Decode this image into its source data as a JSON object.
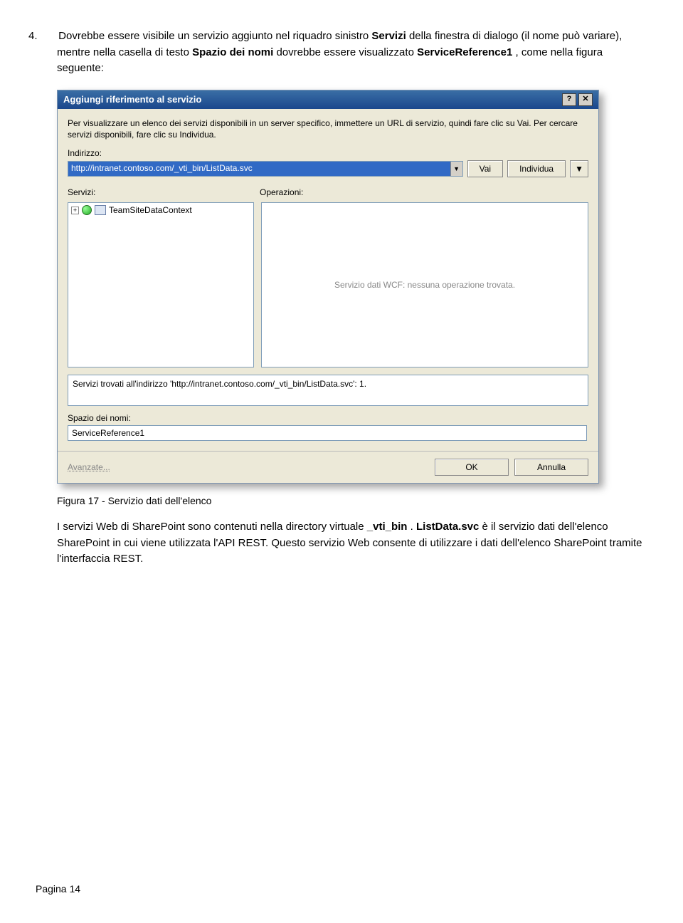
{
  "step": {
    "number": "4.",
    "text_before": "Dovrebbe essere visibile un servizio aggiunto nel riquadro sinistro ",
    "bold1": "Servizi",
    "text_mid1": " della finestra di dialogo (il nome può variare), mentre nella casella di testo ",
    "bold2": "Spazio dei nomi",
    "text_mid2": " dovrebbe essere visualizzato ",
    "bold3": "ServiceReference1",
    "text_after": ", come nella figura seguente:"
  },
  "dialog": {
    "title": "Aggiungi riferimento al servizio",
    "help_btn": "?",
    "close_btn": "✕",
    "desc": "Per visualizzare un elenco dei servizi disponibili in un server specifico, immettere un URL di servizio, quindi fare clic su Vai. Per cercare servizi disponibili, fare clic su Individua.",
    "address_lbl": "Indirizzo:",
    "address_val": "http://intranet.contoso.com/_vti_bin/ListData.svc",
    "go_btn": "Vai",
    "discover_btn": "Individua",
    "dd": "▼",
    "services_lbl": "Servizi:",
    "operations_lbl": "Operazioni:",
    "tree_item": "TeamSiteDataContext",
    "ops_empty": "Servizio dati WCF: nessuna operazione trovata.",
    "status": "Servizi trovati all'indirizzo 'http://intranet.contoso.com/_vti_bin/ListData.svc': 1.",
    "ns_lbl": "Spazio dei nomi:",
    "ns_val": "ServiceReference1",
    "advanced": "Avanzate...",
    "ok": "OK",
    "cancel": "Annulla"
  },
  "caption": "Figura 17 - Servizio dati dell'elenco",
  "after": {
    "p1a": "I servizi Web di SharePoint sono contenuti nella directory virtuale ",
    "b1": "_vti_bin",
    "p1b": ". ",
    "b2": "ListData.svc",
    "p1c": " è il servizio dati dell'elenco SharePoint in cui viene utilizzata l'API REST. Questo servizio Web consente di utilizzare i dati dell'elenco SharePoint tramite l'interfaccia REST."
  },
  "page_footer": "Pagina 14"
}
